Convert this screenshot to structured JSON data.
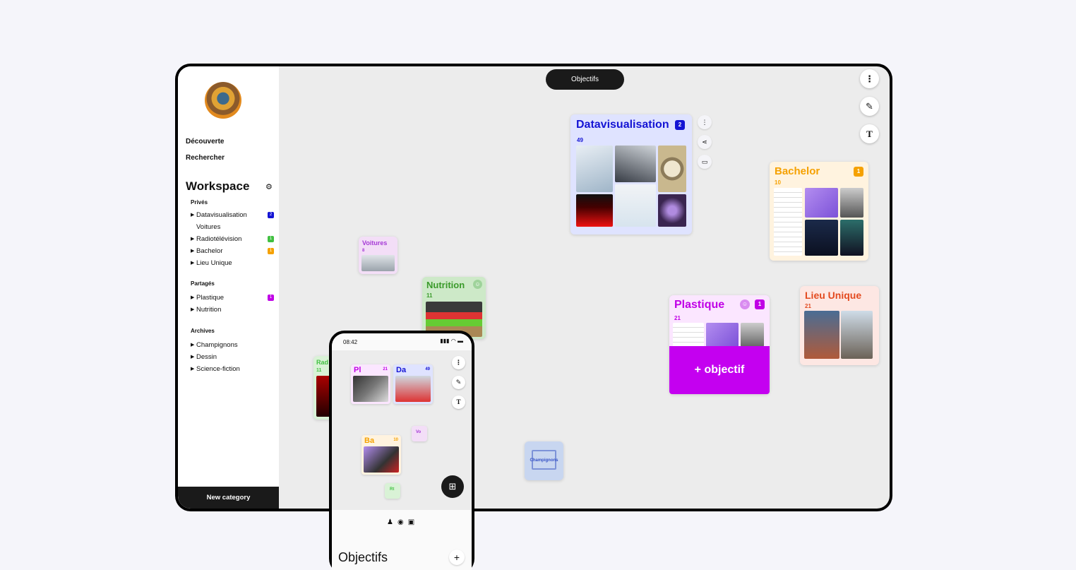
{
  "sidebar": {
    "nav": [
      "Découverte",
      "Rechercher"
    ],
    "workspace_title": "Workspace",
    "sections": {
      "prives": "Privés",
      "partages": "Partagés",
      "archives": "Archives"
    },
    "prives_items": [
      {
        "label": "Datavisualisation",
        "badge": "2",
        "color": "#1414d4"
      },
      {
        "label": "Voitures",
        "badge": "",
        "color": ""
      },
      {
        "label": "Radiotélévision",
        "badge": "1",
        "color": "#41c041"
      },
      {
        "label": "Bachelor",
        "badge": "1",
        "color": "#f5a100"
      },
      {
        "label": "Lieu Unique",
        "badge": "",
        "color": ""
      }
    ],
    "partages_items": [
      {
        "label": "Plastique",
        "badge": "1",
        "color": "#c000e6"
      },
      {
        "label": "Nutrition",
        "badge": "",
        "color": ""
      }
    ],
    "archives_items": [
      "Champignons",
      "Dessin",
      "Science-fiction"
    ],
    "new_category": "New category"
  },
  "canvas": {
    "top_pill": "Objectifs",
    "plus_objectif": "+ objectif",
    "cards": {
      "datavis": {
        "title": "Datavisualisation",
        "count": "49",
        "badge": "2",
        "color": "#1414d4"
      },
      "bachelor": {
        "title": "Bachelor",
        "count": "10",
        "badge": "1",
        "color": "#f5a100"
      },
      "voitures": {
        "title": "Voitures",
        "count": "8",
        "color": "#a63ad6"
      },
      "nutrition": {
        "title": "Nutrition",
        "count": "11",
        "color": "#3a9a2a"
      },
      "plastique": {
        "title": "Plastique",
        "count": "21",
        "badge": "1",
        "color": "#c000e6"
      },
      "lieu": {
        "title": "Lieu Unique",
        "count": "21",
        "color": "#e34a1f"
      },
      "radio": {
        "title": "Rad",
        "count": "11",
        "color": "#41c041"
      },
      "champignons": {
        "title": "Champignons",
        "color": "#3652c6"
      }
    }
  },
  "phone": {
    "time": "08:42",
    "cards": {
      "pl": {
        "title": "Pl",
        "count": "21"
      },
      "da": {
        "title": "Da",
        "count": "49"
      },
      "ba": {
        "title": "Ba",
        "count": "10"
      },
      "vo": {
        "title": "Vo"
      },
      "rt": {
        "title": "Rt"
      }
    },
    "sheet_title": "Objectifs"
  }
}
